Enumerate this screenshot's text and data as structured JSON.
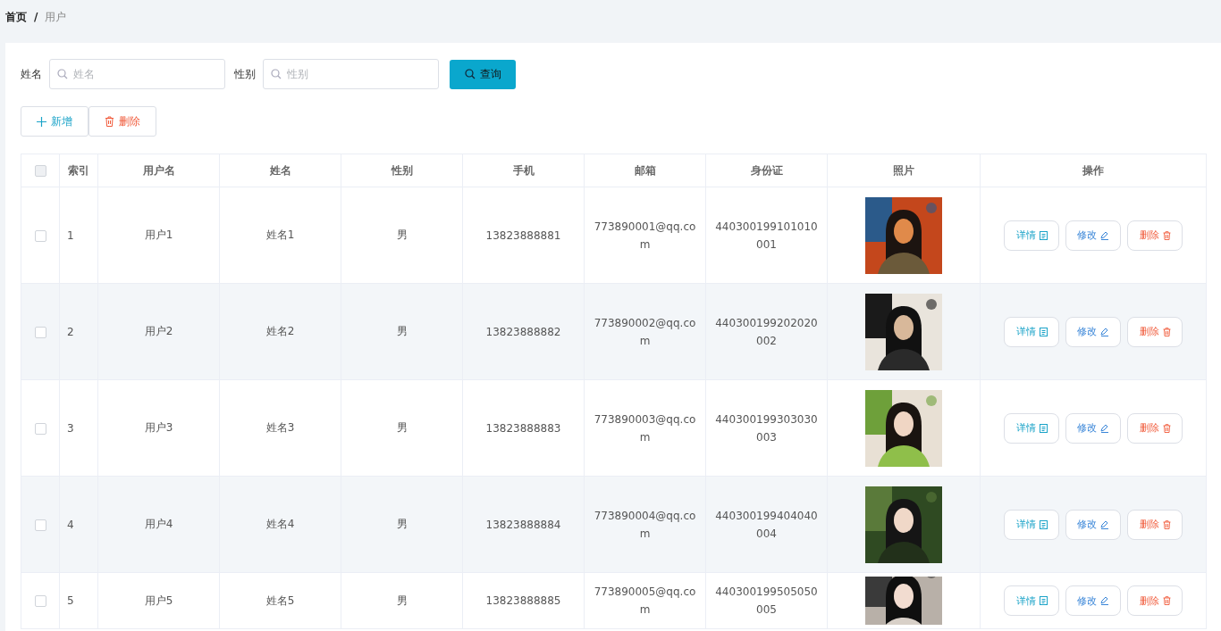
{
  "breadcrumb": [
    {
      "label": "首页",
      "selected": false
    },
    {
      "label": "用户",
      "selected": true
    }
  ],
  "breadcrumb_separator": "/",
  "search": {
    "fields": [
      {
        "label": "姓名",
        "placeholder": "姓名"
      },
      {
        "label": "性别",
        "placeholder": "性别"
      }
    ],
    "button": "查询"
  },
  "toolbar": [
    {
      "kind": "add",
      "label": "新增"
    },
    {
      "kind": "delete",
      "label": "删除"
    }
  ],
  "table": {
    "header_checked": false,
    "columns": [
      "索引",
      "用户名",
      "姓名",
      "性别",
      "手机",
      "邮箱",
      "身份证",
      "照片",
      "操作"
    ],
    "rows": [
      {
        "checked": false,
        "index": "1",
        "username": "用户1",
        "name": "姓名1",
        "gender": "男",
        "phone": "13823888881",
        "email": "773890001@qq.com",
        "id_card": "440300199101010001",
        "actions": [
          {
            "kind": "detail",
            "label": "详情"
          },
          {
            "kind": "edit",
            "label": "修改"
          },
          {
            "kind": "delete",
            "label": "删除"
          }
        ]
      },
      {
        "checked": false,
        "index": "2",
        "username": "用户2",
        "name": "姓名2",
        "gender": "男",
        "phone": "13823888882",
        "email": "773890002@qq.com",
        "id_card": "440300199202020002",
        "actions": [
          {
            "kind": "detail",
            "label": "详情"
          },
          {
            "kind": "edit",
            "label": "修改"
          },
          {
            "kind": "delete",
            "label": "删除"
          }
        ]
      },
      {
        "checked": false,
        "index": "3",
        "username": "用户3",
        "name": "姓名3",
        "gender": "男",
        "phone": "13823888883",
        "email": "773890003@qq.com",
        "id_card": "440300199303030003",
        "actions": [
          {
            "kind": "detail",
            "label": "详情"
          },
          {
            "kind": "edit",
            "label": "修改"
          },
          {
            "kind": "delete",
            "label": "删除"
          }
        ]
      },
      {
        "checked": false,
        "index": "4",
        "username": "用户4",
        "name": "姓名4",
        "gender": "男",
        "phone": "13823888884",
        "email": "773890004@qq.com",
        "id_card": "440300199404040004",
        "actions": [
          {
            "kind": "detail",
            "label": "详情"
          },
          {
            "kind": "edit",
            "label": "修改"
          },
          {
            "kind": "delete",
            "label": "删除"
          }
        ]
      },
      {
        "checked": false,
        "index": "5",
        "username": "用户5",
        "name": "姓名5",
        "gender": "男",
        "phone": "13823888885",
        "email": "773890005@qq.com",
        "id_card": "440300199505050005",
        "actions": [
          {
            "kind": "detail",
            "label": "详情"
          },
          {
            "kind": "edit",
            "label": "修改"
          },
          {
            "kind": "delete",
            "label": "删除"
          }
        ]
      }
    ]
  }
}
